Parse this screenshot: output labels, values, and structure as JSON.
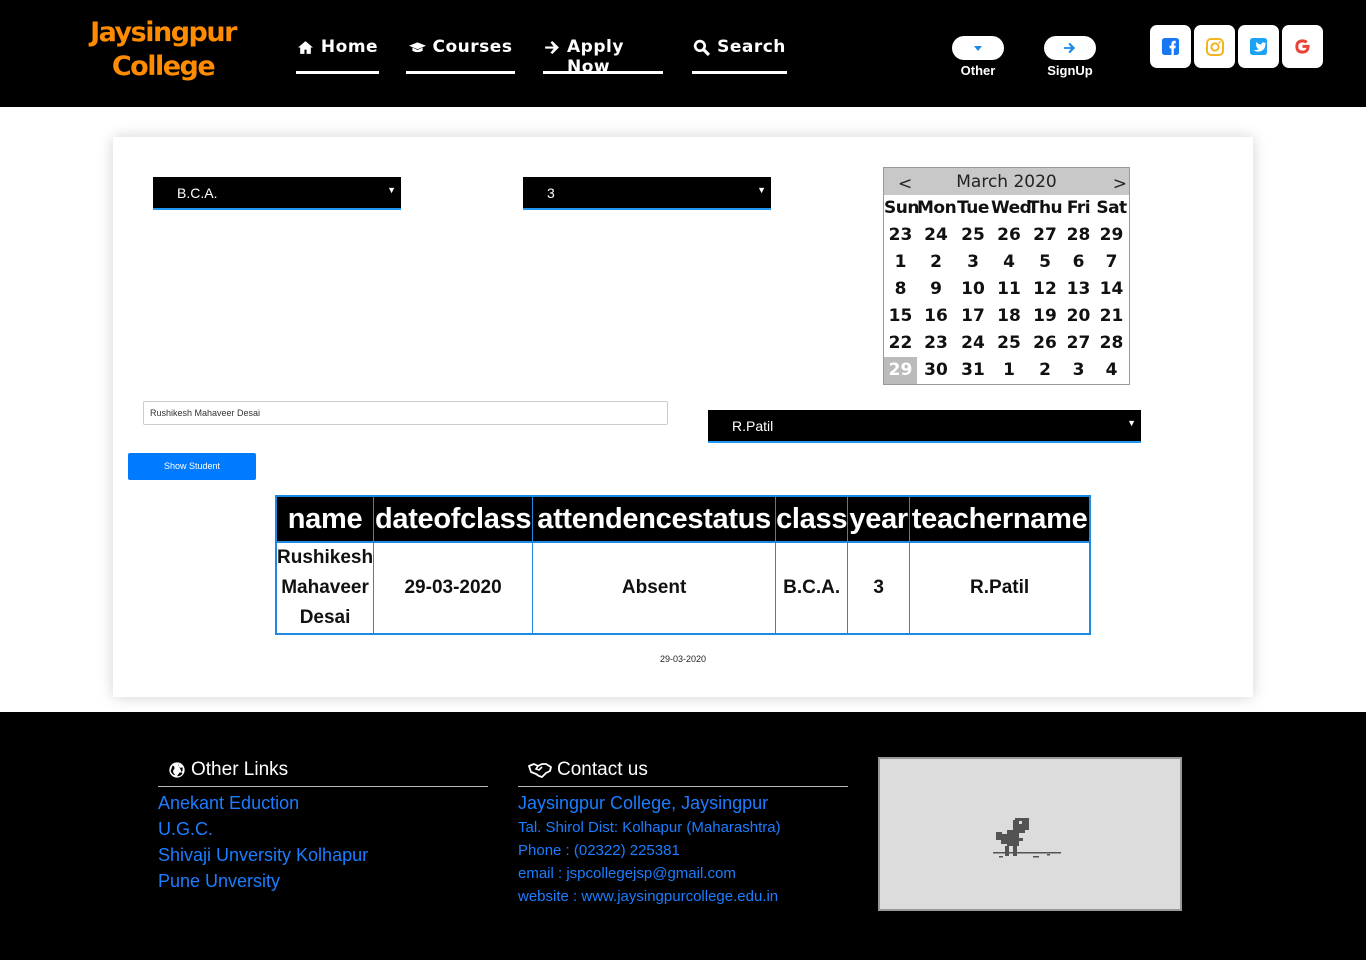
{
  "header": {
    "brand_line1": "Jaysingpur",
    "brand_line2": "College",
    "nav": [
      {
        "label": "Home",
        "icon": "home-icon"
      },
      {
        "label": "Courses",
        "icon": "graduation-cap-icon"
      },
      {
        "label": "Apply Now",
        "icon": "arrow-right-icon"
      },
      {
        "label": "Search",
        "icon": "search-icon"
      }
    ],
    "other_label": "Other",
    "signup_label": "SignUp",
    "social": [
      "facebook-icon",
      "instagram-icon",
      "twitter-icon",
      "google-icon"
    ]
  },
  "form": {
    "course_select": "B.C.A.",
    "year_select": "3",
    "student_name": "Rushikesh Mahaveer Desai",
    "teacher_select": "R.Patil",
    "show_button": "Show Student"
  },
  "calendar": {
    "month_title": "March 2020",
    "prev": "<",
    "next": ">",
    "weekdays": [
      "Sun",
      "Mon",
      "Tue",
      "Wed",
      "Thu",
      "Fri",
      "Sat"
    ],
    "days": [
      "23",
      "24",
      "25",
      "26",
      "27",
      "28",
      "29",
      "1",
      "2",
      "3",
      "4",
      "5",
      "6",
      "7",
      "8",
      "9",
      "10",
      "11",
      "12",
      "13",
      "14",
      "15",
      "16",
      "17",
      "18",
      "19",
      "20",
      "21",
      "22",
      "23",
      "24",
      "25",
      "26",
      "27",
      "28",
      "29",
      "30",
      "31",
      "1",
      "2",
      "3",
      "4"
    ],
    "selected_index": 35
  },
  "table": {
    "headers": [
      "name",
      "dateofclass",
      "attendencestatus",
      "class",
      "year",
      "teachername"
    ],
    "rows": [
      [
        "Rushikesh Mahaveer Desai",
        "29-03-2020",
        "Absent",
        "B.C.A.",
        "3",
        "R.Patil"
      ]
    ]
  },
  "selected_date": "29-03-2020",
  "footer": {
    "links_title": "Other Links",
    "links": [
      "Anekant Eduction",
      "U.G.C.",
      "Shivaji Unversity Kolhapur",
      "Pune Unversity"
    ],
    "contact_title": "Contact us",
    "contact_name": "Jaysingpur College, Jaysingpur",
    "contact_lines": [
      "Tal. Shirol Dist: Kolhapur (Maharashtra)",
      "Phone : (02322) 225381",
      "email : jspcollegejsp@gmail.com",
      "website : www.jaysingpurcollege.edu.in"
    ]
  },
  "colors": {
    "brand": "#ff8c00",
    "accent": "#1e88e5",
    "button": "#007bff",
    "footer_link": "#1b7dff"
  }
}
